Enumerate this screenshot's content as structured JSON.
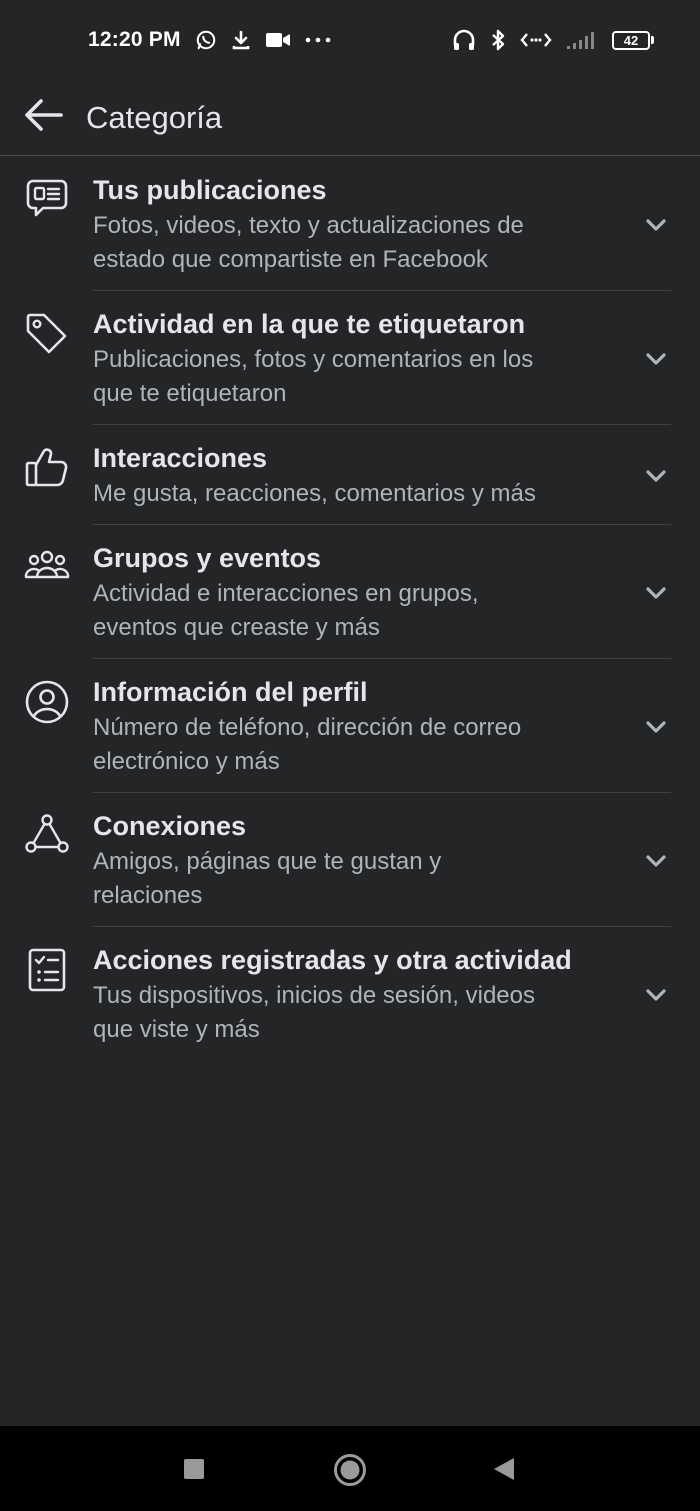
{
  "status_bar": {
    "time": "12:20 PM",
    "battery_level": "42",
    "icons_left": [
      "whatsapp-icon",
      "download-icon",
      "video-camera-icon",
      "more-dots-icon"
    ],
    "icons_right": [
      "headphones-icon",
      "bluetooth-icon",
      "data-transfer-icon",
      "signal-icon",
      "battery-icon"
    ]
  },
  "header": {
    "title": "Categoría"
  },
  "categories": [
    {
      "title": "Tus publicaciones",
      "desc_line1": "Fotos, videos, texto y actualizaciones de",
      "desc_line2": "estado que compartiste en Facebook",
      "icon": "posts-icon"
    },
    {
      "title": "Actividad en la que te etiquetaron",
      "desc_line1": "Publicaciones, fotos y comentarios en los",
      "desc_line2": "que te etiquetaron",
      "icon": "tag-icon"
    },
    {
      "title": "Interacciones",
      "desc_line1": "Me gusta, reacciones, comentarios y más",
      "desc_line2": "",
      "icon": "thumbs-up-icon"
    },
    {
      "title": "Grupos y eventos",
      "desc_line1": "Actividad e interacciones en grupos,",
      "desc_line2": "eventos que creaste y más",
      "icon": "groups-icon"
    },
    {
      "title": "Información del perfil",
      "desc_line1": "Número de teléfono, dirección de correo",
      "desc_line2": "electrónico y más",
      "icon": "profile-icon"
    },
    {
      "title": "Conexiones",
      "desc_line1": "Amigos, páginas que te gustan y",
      "desc_line2": "relaciones",
      "icon": "connections-icon"
    },
    {
      "title": "Acciones registradas y otra actividad",
      "desc_line1": "Tus dispositivos, inicios de sesión, videos",
      "desc_line2": "que viste y más",
      "icon": "checklist-icon"
    }
  ],
  "colors": {
    "background": "#242526",
    "title_text": "#e4e6eb",
    "secondary_text": "#b0b3b8",
    "divider": "#3e4042",
    "nav_bar": "#000000"
  }
}
